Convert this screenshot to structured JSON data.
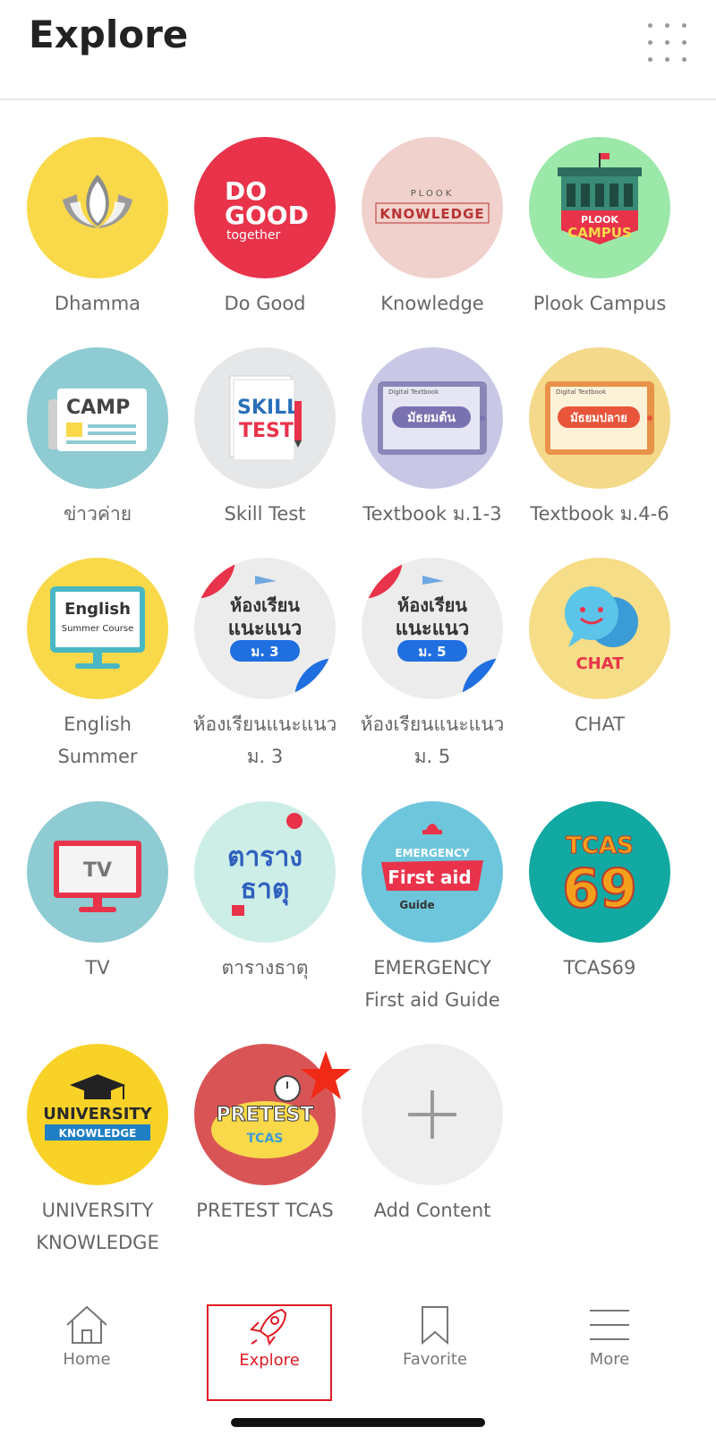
{
  "header": {
    "title": "Explore",
    "menu_icon": "grid-dots-icon"
  },
  "tiles": [
    {
      "label": "Dhamma",
      "icon": "lotus-icon",
      "bg": "#f9d94a"
    },
    {
      "label": "Do Good",
      "icon": "do-good-logo",
      "bg": "#e8334a",
      "art": [
        "DO",
        "GOOD",
        "together"
      ]
    },
    {
      "label": "Knowledge",
      "icon": "plook-knowledge-logo",
      "bg": "#f1d1cc",
      "art": [
        "PLOOK",
        "KNOWLEDGE"
      ]
    },
    {
      "label": "Plook Campus",
      "icon": "plook-campus-logo",
      "bg": "#9be8a8",
      "art": [
        "PLOOK",
        "CAMPUS"
      ]
    },
    {
      "label": "ข่าวค่าย",
      "icon": "camp-news-icon",
      "bg": "#8ecbd2",
      "art": [
        "CAMP"
      ]
    },
    {
      "label": "Skill Test",
      "icon": "skill-test-icon",
      "bg": "#e6e7e8",
      "art": [
        "SKILL",
        "TEST"
      ]
    },
    {
      "label": "Textbook ม.1-3",
      "icon": "digital-textbook-icon",
      "bg": "#c8c8e6",
      "art": [
        "Digital Textbook",
        "มัธยมต้น"
      ]
    },
    {
      "label": "Textbook ม.4-6",
      "icon": "digital-textbook-icon",
      "bg": "#f4d98a",
      "art": [
        "Digital Textbook",
        "มัธยมปลาย"
      ]
    },
    {
      "label": "English\nSummer",
      "icon": "english-summer-icon",
      "bg": "#f9d94a",
      "art": [
        "English",
        "Summer Course"
      ]
    },
    {
      "label": "ห้องเรียนแนะแนว\nม. 3",
      "icon": "guidance-class-icon",
      "bg": "#ececec",
      "art": [
        "ห้องเรียน",
        "แนะแนว",
        "ม. 3"
      ]
    },
    {
      "label": "ห้องเรียนแนะแนว\nม. 5",
      "icon": "guidance-class-icon",
      "bg": "#ececec",
      "art": [
        "ห้องเรียน",
        "แนะแนว",
        "ม. 5"
      ]
    },
    {
      "label": "CHAT",
      "icon": "chat-bubbles-icon",
      "bg": "#f6dd87",
      "art": [
        "CHAT"
      ]
    },
    {
      "label": "TV",
      "icon": "tv-icon",
      "bg": "#8ecbd2",
      "art": [
        "TV"
      ]
    },
    {
      "label": "ตารางธาตุ",
      "icon": "periodic-table-icon",
      "bg": "#cdeee6",
      "art": [
        "ตาราง",
        "ธาตุ"
      ]
    },
    {
      "label": "EMERGENCY\nFirst aid Guide",
      "icon": "first-aid-icon",
      "bg": "#6ec6dc",
      "art": [
        "EMERGENCY",
        "First aid",
        "Guide"
      ]
    },
    {
      "label": "TCAS69",
      "icon": "tcas69-logo",
      "bg": "#11a9a1",
      "art": [
        "TCAS",
        "69"
      ]
    },
    {
      "label": "UNIVERSITY\nKNOWLEDGE",
      "icon": "graduation-cap-icon",
      "bg": "#f9d228",
      "art": [
        "UNIVERSITY",
        "KNOWLEDGE"
      ]
    },
    {
      "label": "PRETEST TCAS",
      "icon": "pretest-stopwatch-icon",
      "bg": "#d95555",
      "art": [
        "PRETEST",
        "TCAS"
      ]
    },
    {
      "label": "Add Content",
      "icon": "plus-icon",
      "bg": "#eeeeee"
    }
  ],
  "badge": {
    "icon": "star-icon",
    "color": "#f02a16"
  },
  "tabbar": {
    "items": [
      {
        "label": "Home",
        "icon": "home-icon"
      },
      {
        "label": "Explore",
        "icon": "rocket-icon",
        "active": true
      },
      {
        "label": "Favorite",
        "icon": "bookmark-icon"
      },
      {
        "label": "More",
        "icon": "hamburger-menu-icon"
      }
    ],
    "active_color": "#e01b24"
  }
}
